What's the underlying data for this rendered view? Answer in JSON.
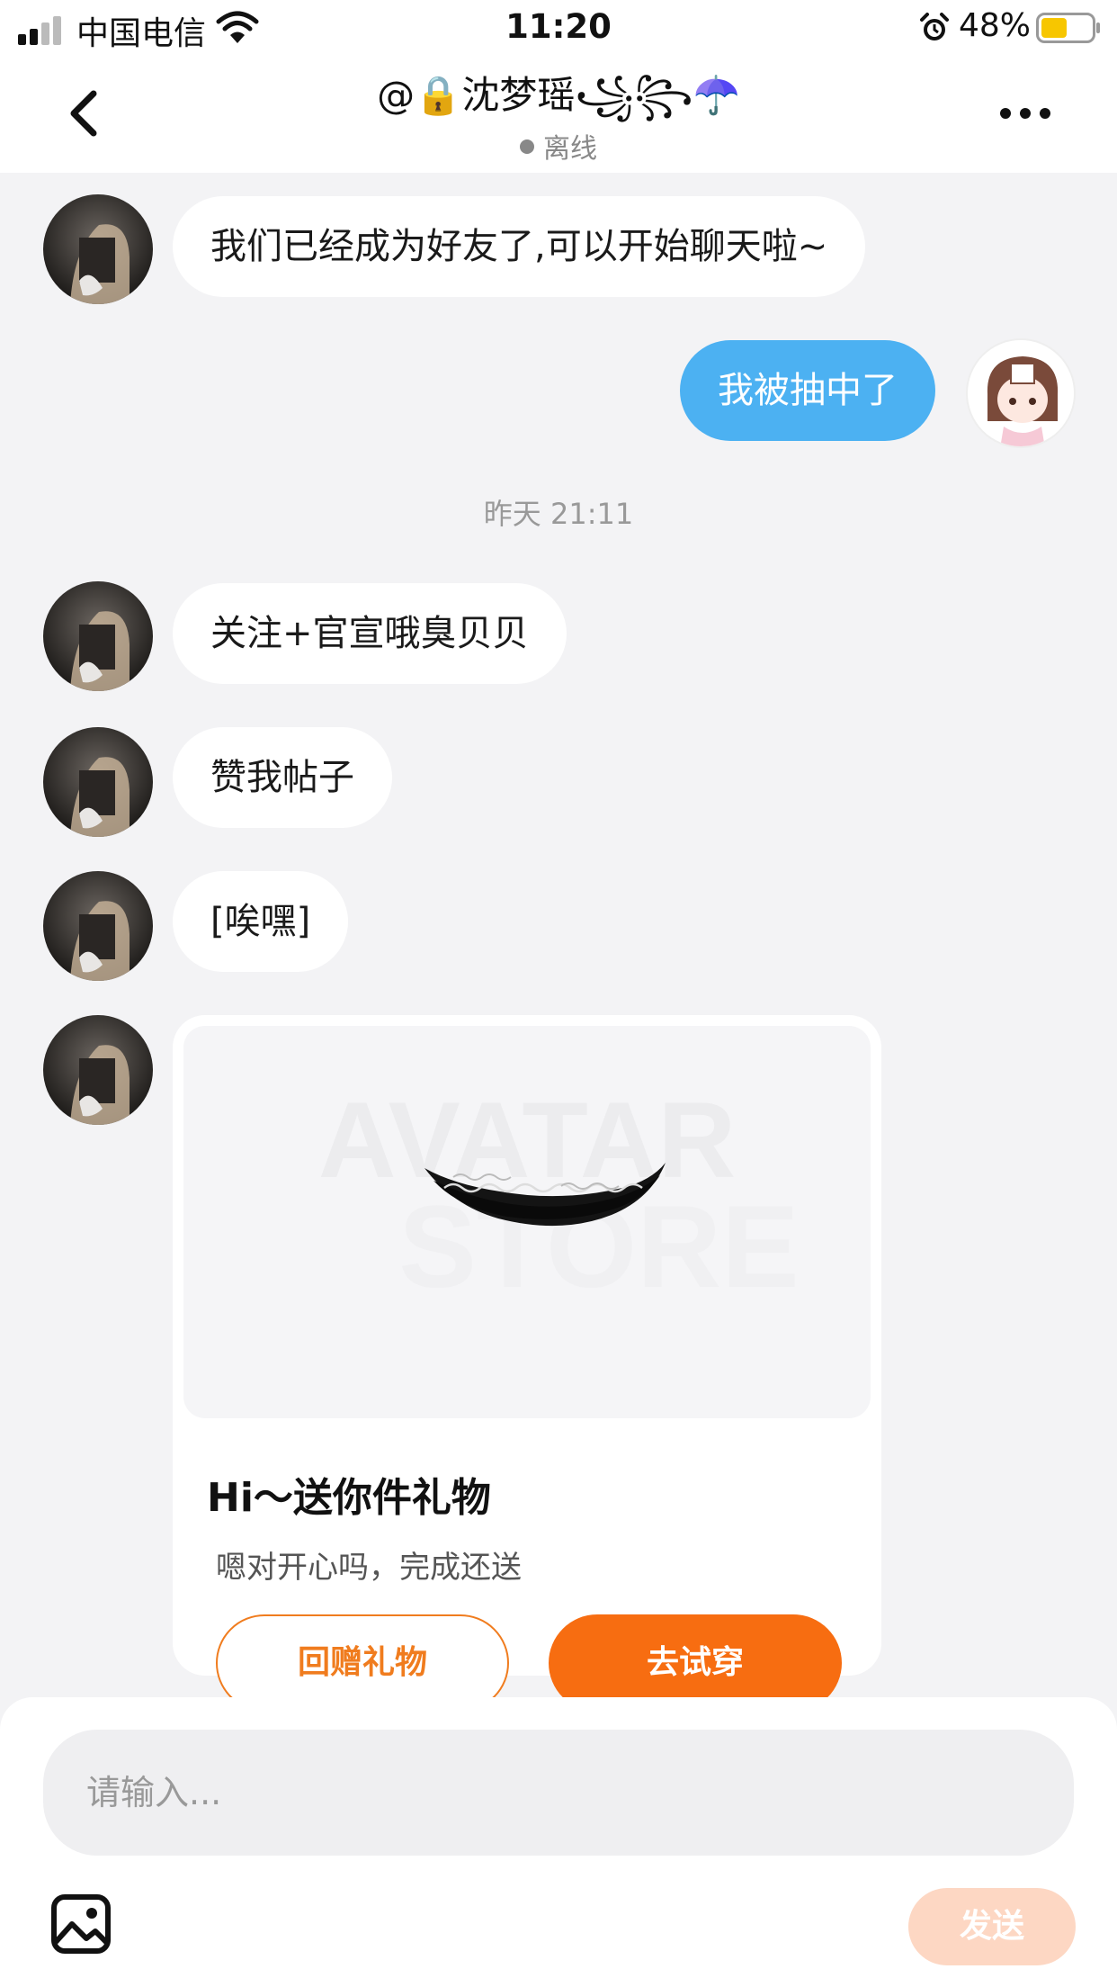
{
  "status_bar": {
    "carrier": "中国电信",
    "time": "11:20",
    "battery_percent": "48%"
  },
  "header": {
    "title": "@🔒沈梦瑶꧁꧂☂️",
    "status": "离线"
  },
  "messages": [
    {
      "side": "left",
      "text": "我们已经成为好友了,可以开始聊天啦~"
    },
    {
      "side": "right",
      "text": "我被抽中了"
    },
    {
      "type": "timestamp",
      "text": "昨天 21:11"
    },
    {
      "side": "left",
      "text": "关注+官宣哦臭贝贝"
    },
    {
      "side": "left",
      "text": "赞我帖子"
    },
    {
      "side": "left",
      "text": "[唉嘿]"
    }
  ],
  "gift_card": {
    "watermark_line1": "AVATAR",
    "watermark_line2": "STORE",
    "title": "Hi～送你件礼物",
    "subtitle": "嗯对开心吗，完成还送",
    "return_gift_label": "回赠礼物",
    "try_on_label": "去试穿"
  },
  "composer": {
    "placeholder": "请输入...",
    "send_label": "发送"
  },
  "colors": {
    "accent_orange": "#f76d11",
    "bubble_blue": "#4cb1f2",
    "send_disabled": "#fdd7c3"
  }
}
